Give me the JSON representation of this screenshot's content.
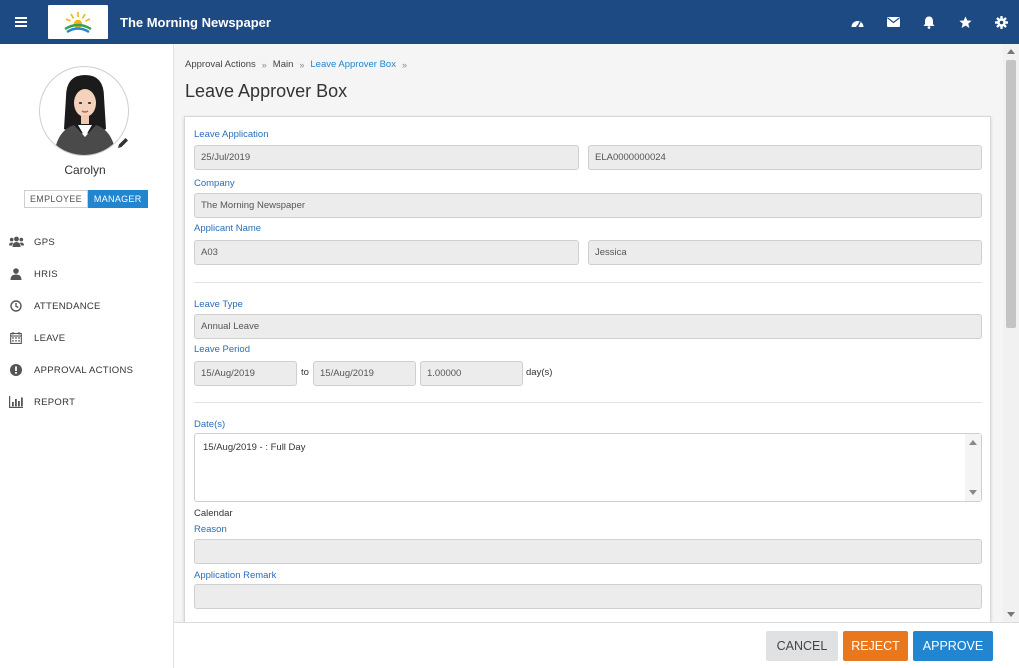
{
  "app": {
    "title": "The Morning Newspaper"
  },
  "user": {
    "name": "Carolyn",
    "roles": {
      "employee": "EMPLOYEE",
      "manager": "MANAGER"
    }
  },
  "nav": [
    {
      "label": "GPS",
      "icon": "group-icon"
    },
    {
      "label": "HRIS",
      "icon": "user-icon"
    },
    {
      "label": "ATTENDANCE",
      "icon": "clock-icon"
    },
    {
      "label": "LEAVE",
      "icon": "calendar-icon"
    },
    {
      "label": "APPROVAL ACTIONS",
      "icon": "exclamation-circle-icon"
    },
    {
      "label": "REPORT",
      "icon": "bar-chart-icon"
    }
  ],
  "breadcrumb": [
    "Approval Actions",
    "Main",
    "Leave Approver Box"
  ],
  "page": {
    "title": "Leave Approver Box"
  },
  "form": {
    "leave_application_label": "Leave Application",
    "application_date": "25/Jul/2019",
    "application_no": "ELA0000000024",
    "company_label": "Company",
    "company": "The Morning Newspaper",
    "applicant_label": "Applicant Name",
    "applicant_code": "A03",
    "applicant_name": "Jessica",
    "leave_type_label": "Leave Type",
    "leave_type": "Annual Leave",
    "leave_period_label": "Leave Period",
    "period_from": "15/Aug/2019",
    "to_label": "to",
    "period_to": "15/Aug/2019",
    "days": "1.00000",
    "days_unit": "day(s)",
    "dates_label": "Date(s)",
    "dates_value": "15/Aug/2019 - : Full Day",
    "calendar_label": "Calendar",
    "reason_label": "Reason",
    "reason": "",
    "remark_label": "Application Remark",
    "remark": ""
  },
  "actions": {
    "cancel": "CANCEL",
    "reject": "REJECT",
    "approve": "APPROVE"
  },
  "colors": {
    "header": "#1d4a82",
    "accent": "#2185d0",
    "reject": "#e8771e"
  }
}
